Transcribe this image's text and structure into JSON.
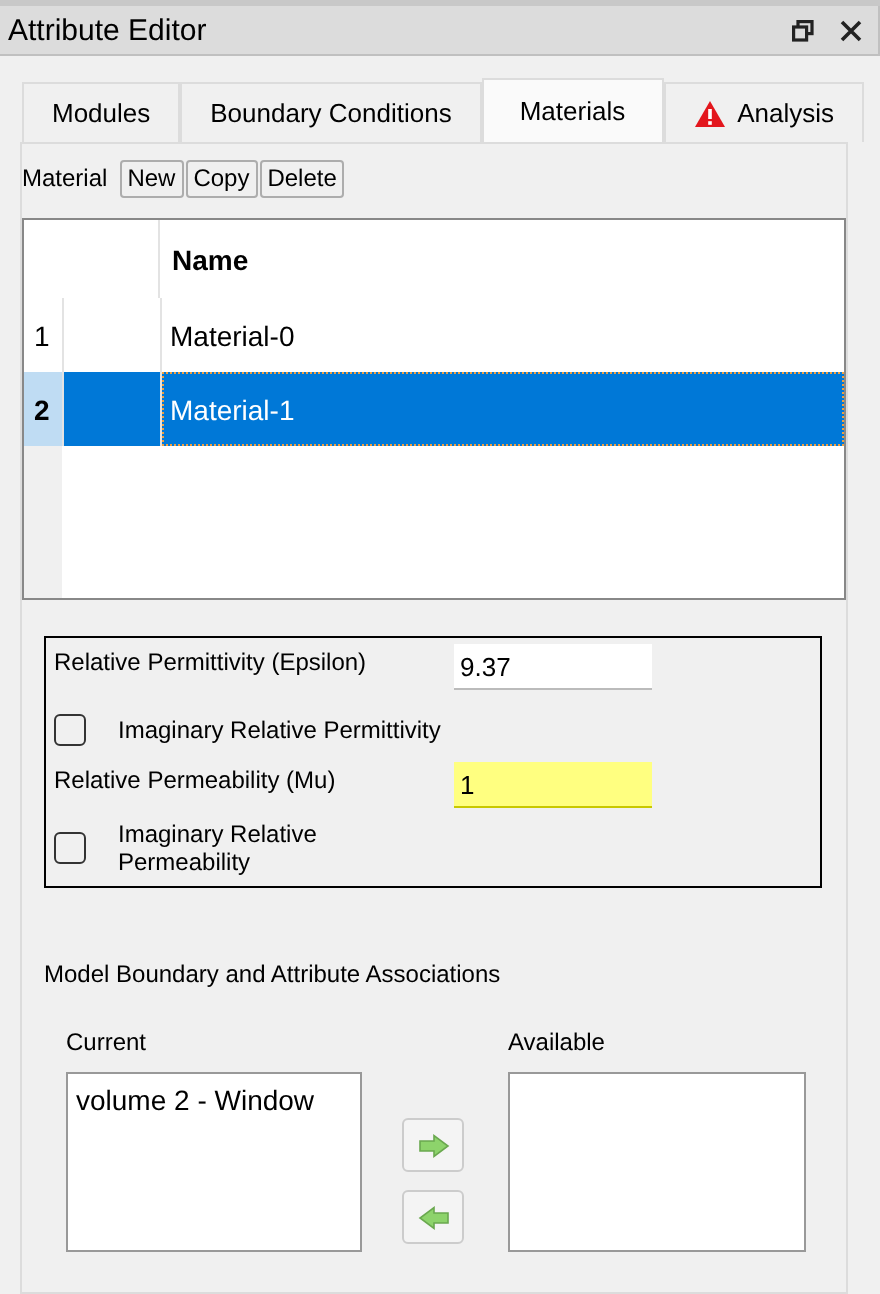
{
  "window": {
    "title": "Attribute Editor"
  },
  "tabs": [
    {
      "label": "Modules",
      "selected": false,
      "warning": false
    },
    {
      "label": "Boundary Conditions",
      "selected": false,
      "warning": false
    },
    {
      "label": "Materials",
      "selected": true,
      "warning": false
    },
    {
      "label": "Analysis",
      "selected": false,
      "warning": true
    }
  ],
  "toolbar": {
    "label": "Material",
    "buttons": [
      "New",
      "Copy",
      "Delete"
    ]
  },
  "table": {
    "columns": [
      "Name"
    ],
    "rows": [
      {
        "number": "1",
        "name": "Material-0",
        "selected": false
      },
      {
        "number": "2",
        "name": "Material-1",
        "selected": true
      }
    ]
  },
  "properties": [
    {
      "kind": "field",
      "label": "Relative Permittivity (Epsilon)",
      "value": "9.37",
      "highlighted": false
    },
    {
      "kind": "checkbox",
      "label": "Imaginary Relative Permittivity",
      "checked": false
    },
    {
      "kind": "field",
      "label": "Relative Permeability (Mu)",
      "value": "1",
      "highlighted": true
    },
    {
      "kind": "checkbox",
      "label": "Imaginary Relative Permeability",
      "checked": false
    }
  ],
  "associations": {
    "title": "Model Boundary and Attribute Associations",
    "current": {
      "label": "Current",
      "items": [
        "volume 2 - Window"
      ]
    },
    "available": {
      "label": "Available"
    }
  }
}
